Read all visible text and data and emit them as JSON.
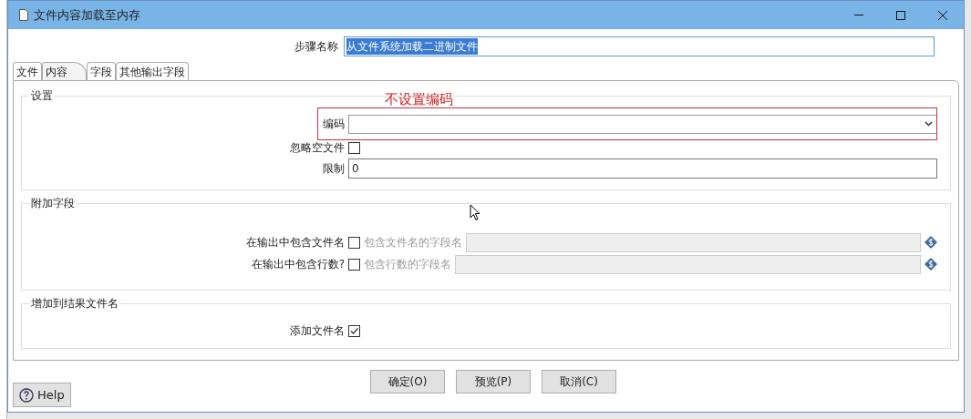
{
  "window": {
    "title": "文件内容加载至内存"
  },
  "step_name": {
    "label": "步骤名称",
    "value": "从文件系统加载二进制文件"
  },
  "tabs": [
    {
      "label": "文件",
      "selected": false
    },
    {
      "label": "内容",
      "selected": true
    },
    {
      "label": "字段",
      "selected": false
    },
    {
      "label": "其他输出字段",
      "selected": false
    }
  ],
  "annotation": {
    "text": "不设置编码"
  },
  "settings": {
    "title": "设置",
    "encoding": {
      "label": "编码"
    },
    "ignore_empty": {
      "label": "忽略空文件",
      "checked": false
    },
    "limit": {
      "label": "限制",
      "value": "0"
    }
  },
  "additional_fields": {
    "title": "附加字段",
    "rows": [
      {
        "label": "在输出中包含文件名",
        "checked": false,
        "field_label": "包含文件名的字段名",
        "disabled": true
      },
      {
        "label": "在输出中包含行数?",
        "checked": false,
        "field_label": "包含行数的字段名",
        "disabled": true
      }
    ]
  },
  "result_files": {
    "title": "增加到结果文件名",
    "add_filename": {
      "label": "添加文件名",
      "checked": true
    }
  },
  "buttons": [
    "确定(O)",
    "预览(P)",
    "取消(C)"
  ],
  "help": {
    "label": "Help"
  }
}
